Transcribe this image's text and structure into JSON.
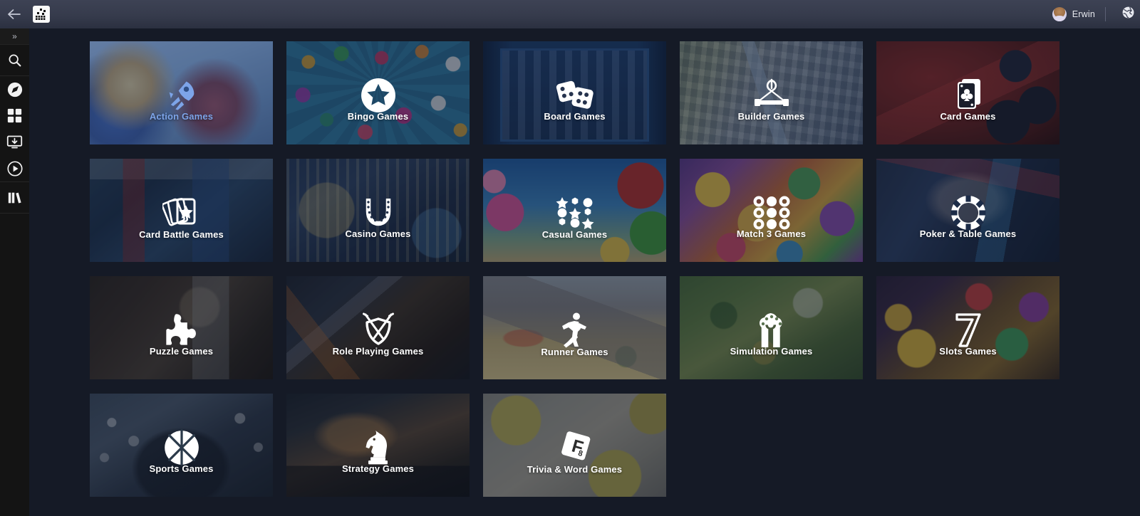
{
  "titlebar": {
    "back_icon": "back-arrow-icon",
    "app_icon": "app-logo-icon",
    "username": "Erwin",
    "avatar_icon": "user-avatar",
    "globe_icon": "globe-icon"
  },
  "sidebar": {
    "expand_label": "»",
    "items": [
      {
        "name": "search",
        "icon": "search-icon"
      },
      {
        "name": "discover",
        "icon": "compass-icon"
      },
      {
        "name": "apps",
        "icon": "grid-icon"
      },
      {
        "name": "downloads",
        "icon": "download-to-computer-icon"
      },
      {
        "name": "play",
        "icon": "play-circle-icon"
      },
      {
        "name": "library",
        "icon": "library-books-icon"
      }
    ]
  },
  "grid": {
    "tiles": [
      {
        "label": "Action Games",
        "icon": "rocket-icon",
        "art": "art-action",
        "selected": true
      },
      {
        "label": "Bingo Games",
        "icon": "star-circle-icon",
        "art": "art-bingo",
        "selected": false
      },
      {
        "label": "Board Games",
        "icon": "dice-icon",
        "art": "art-board",
        "selected": false
      },
      {
        "label": "Builder Games",
        "icon": "crane-icon",
        "art": "art-builder",
        "selected": false
      },
      {
        "label": "Card Games",
        "icon": "playing-cards-icon",
        "art": "art-card",
        "selected": false
      },
      {
        "label": "Card Battle Games",
        "icon": "card-star-icon",
        "art": "art-cardbattle",
        "selected": false
      },
      {
        "label": "Casino Games",
        "icon": "horseshoe-icon",
        "art": "art-casino",
        "selected": false
      },
      {
        "label": "Casual Games",
        "icon": "shapes-grid-icon",
        "art": "art-casual",
        "selected": false
      },
      {
        "label": "Match 3 Games",
        "icon": "dots-grid-icon",
        "art": "art-match3",
        "selected": false
      },
      {
        "label": "Poker & Table Games",
        "icon": "poker-chip-icon",
        "art": "art-poker",
        "selected": false
      },
      {
        "label": "Puzzle Games",
        "icon": "puzzle-piece-icon",
        "art": "art-puzzle",
        "selected": false
      },
      {
        "label": "Role Playing Games",
        "icon": "shield-swords-icon",
        "art": "art-rpg",
        "selected": false
      },
      {
        "label": "Runner Games",
        "icon": "running-man-icon",
        "art": "art-runner",
        "selected": false
      },
      {
        "label": "Simulation Games",
        "icon": "tree-icon",
        "art": "art-sim",
        "selected": false
      },
      {
        "label": "Slots Games",
        "icon": "seven-icon",
        "art": "art-slots",
        "selected": false
      },
      {
        "label": "Sports Games",
        "icon": "basketball-icon",
        "art": "art-sports",
        "selected": false
      },
      {
        "label": "Strategy Games",
        "icon": "chess-knight-icon",
        "art": "art-strategy",
        "selected": false
      },
      {
        "label": "Trivia & Word Games",
        "icon": "letter-tiles-icon",
        "art": "art-trivia",
        "selected": false
      }
    ]
  },
  "colors": {
    "background": "#151a26",
    "titlebar_top": "#3d4254",
    "titlebar_bottom": "#2b3040",
    "sidebar": "#141414",
    "accent_selected": "#7da4e8",
    "label_text": "#ffffff"
  }
}
